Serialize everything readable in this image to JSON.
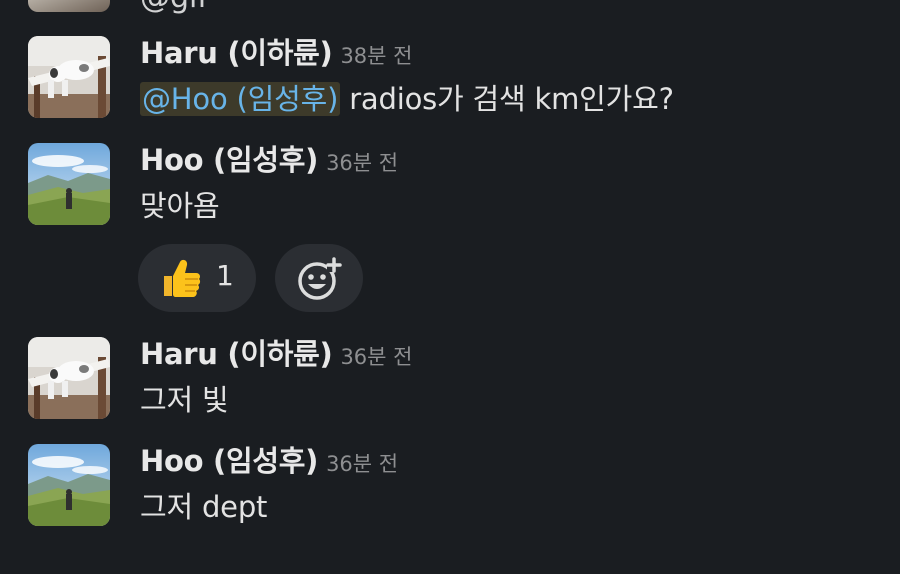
{
  "previous_message": {
    "text": "@gif"
  },
  "messages": [
    {
      "author": "Haru (이하륜)",
      "time": "38분 전",
      "mention": "@Hoo (임성후)",
      "text": " radios가 검색 km인가요?",
      "avatar": "cat-avatar"
    },
    {
      "author": "Hoo (임성후)",
      "time": "36분 전",
      "text": "맞아욤",
      "avatar": "mountain-avatar",
      "reaction": {
        "emoji": "thumbs-up-icon",
        "count": "1"
      },
      "add_reaction_icon": "add-reaction-icon"
    },
    {
      "author": "Haru (이하륜)",
      "time": "36분 전",
      "text": "그저 빛",
      "avatar": "cat-avatar"
    },
    {
      "author": "Hoo (임성후)",
      "time": "36분 전",
      "text": "그저 dept",
      "avatar": "mountain-avatar"
    }
  ],
  "colors": {
    "background": "#1a1d21",
    "mention_text": "#68b4e8",
    "mention_bg": "#3d3a2a",
    "reaction_pill": "#2b2e33"
  }
}
